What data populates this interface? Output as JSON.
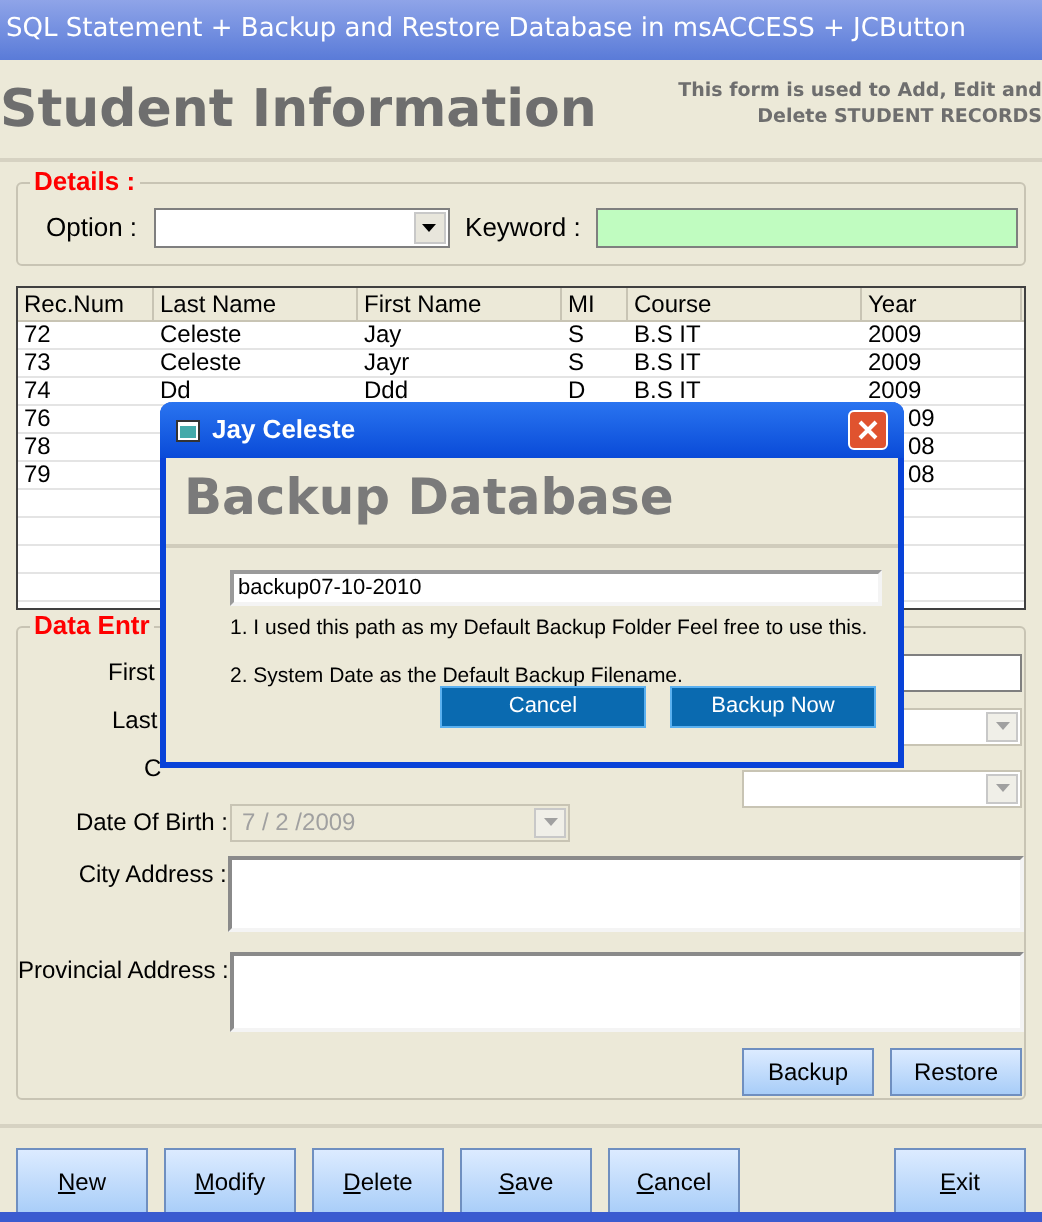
{
  "window": {
    "title": "SQL Statement + Backup and Restore Database in msACCESS +  JCButton"
  },
  "header": {
    "title": "Student Information",
    "note_lines": [
      "This form is used to Add, Edit and",
      "Delete STUDENT RECORDS"
    ]
  },
  "details": {
    "legend": "Details :",
    "option_label": "Option :",
    "keyword_label": "Keyword :"
  },
  "table": {
    "columns": [
      "Rec.Num",
      "Last Name",
      "First Name",
      "MI",
      "Course",
      "Year"
    ],
    "rows": [
      {
        "rec": "72",
        "last": "Celeste",
        "first": "Jay",
        "mi": "S",
        "course": "B.S  IT",
        "year": "2009"
      },
      {
        "rec": "73",
        "last": "Celeste",
        "first": "Jayr",
        "mi": "S",
        "course": "B.S  IT",
        "year": "2009"
      },
      {
        "rec": "74",
        "last": "Dd",
        "first": "Ddd",
        "mi": "D",
        "course": "B.S  IT",
        "year": "2009"
      },
      {
        "rec": "76",
        "year": "09"
      },
      {
        "rec": "78",
        "year": "08"
      },
      {
        "rec": "79",
        "year": "08"
      }
    ]
  },
  "data_entry": {
    "legend": "Data Entr",
    "hidden_labels": [
      "First",
      "Last",
      "C"
    ],
    "dob_label": "Date Of Birth :",
    "dob_value": "7 / 2 /2009",
    "dob_disabled": true,
    "city_label": "City Address :",
    "provincial_label": "Provincial  Address :",
    "buttons": [
      "Backup",
      "Restore"
    ]
  },
  "actions": [
    "New",
    "Modify",
    "Delete",
    "Save",
    "Cancel",
    "Exit"
  ],
  "dialog": {
    "title": "Jay Celeste",
    "heading": "Backup Database",
    "filename": "backup07-10-2010",
    "notes": [
      "1. I used this path as my Default Backup Folder  Feel free to use this.",
      "2. System Date  as the Default Backup Filename."
    ],
    "buttons": [
      "Cancel",
      "Backup Now"
    ]
  }
}
